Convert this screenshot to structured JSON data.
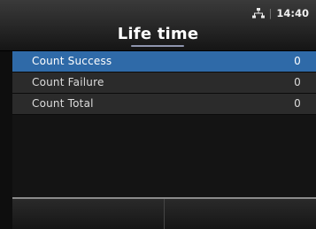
{
  "header": {
    "title": "Life time",
    "time": "14:40",
    "network_icon": "network-icon"
  },
  "list": {
    "rows": [
      {
        "label": "Count Success",
        "value": "0",
        "selected": true
      },
      {
        "label": "Count Failure",
        "value": "0",
        "selected": false
      },
      {
        "label": "Count Total",
        "value": "0",
        "selected": false
      }
    ]
  },
  "colors": {
    "selected_row": "#2f6aa8",
    "row": "#2b2b2b",
    "background": "#0e0e0e"
  }
}
